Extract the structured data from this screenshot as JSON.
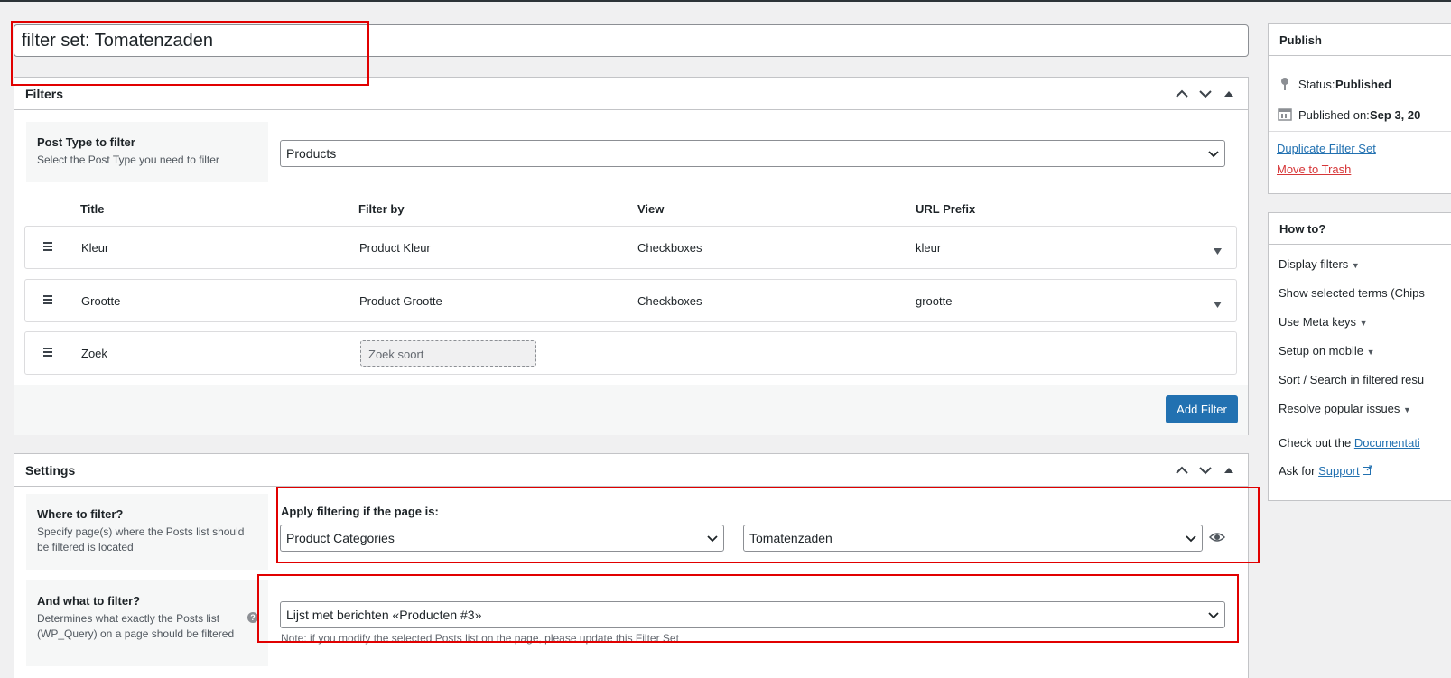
{
  "title_input": {
    "value": "filter set: Tomatenzaden"
  },
  "filters_box": {
    "title": "Filters",
    "post_type": {
      "label": "Post Type to filter",
      "desc": "Select the Post Type you need to filter",
      "value": "Products"
    },
    "columns": [
      "Title",
      "Filter by",
      "View",
      "URL Prefix"
    ],
    "rows": [
      {
        "title": "Kleur",
        "filter_by": "Product Kleur",
        "view": "Checkboxes",
        "prefix": "kleur"
      },
      {
        "title": "Grootte",
        "filter_by": "Product Grootte",
        "view": "Checkboxes",
        "prefix": "grootte"
      },
      {
        "title": "Zoek",
        "search_placeholder": "Zoek soort"
      }
    ],
    "add_button": "Add Filter"
  },
  "settings_box": {
    "title": "Settings",
    "where": {
      "label": "Where to filter?",
      "desc": "Specify page(s) where the Posts list should be filtered is located",
      "apply_label": "Apply filtering if the page is:",
      "select1": "Product Categories",
      "select2": "Tomatenzaden"
    },
    "what": {
      "label": "And what to filter?",
      "desc": "Determines what exactly the Posts list (WP_Query) on a page should be filtered",
      "select": "Lijst met berichten «Producten #3»",
      "note": "Note: if you modify the selected Posts list on the page, please update this Filter Set"
    }
  },
  "publish": {
    "title": "Publish",
    "status_label": "Status:",
    "status_value": "Published",
    "published_label": "Published on:",
    "published_value": "Sep 3, 20",
    "duplicate": "Duplicate Filter Set",
    "trash": "Move to Trash"
  },
  "howto": {
    "title": "How to?",
    "items": [
      "Display filters",
      "Show selected terms (Chips",
      "Use Meta keys",
      "Setup on mobile",
      "Sort / Search in filtered resu",
      "Resolve popular issues"
    ],
    "check_text": "Check out the",
    "check_link": "Documentati",
    "ask_text": "Ask for",
    "ask_link": "Support"
  },
  "colors": {
    "accent": "#2271b1",
    "danger": "#d63638",
    "highlight": "#e10000"
  }
}
